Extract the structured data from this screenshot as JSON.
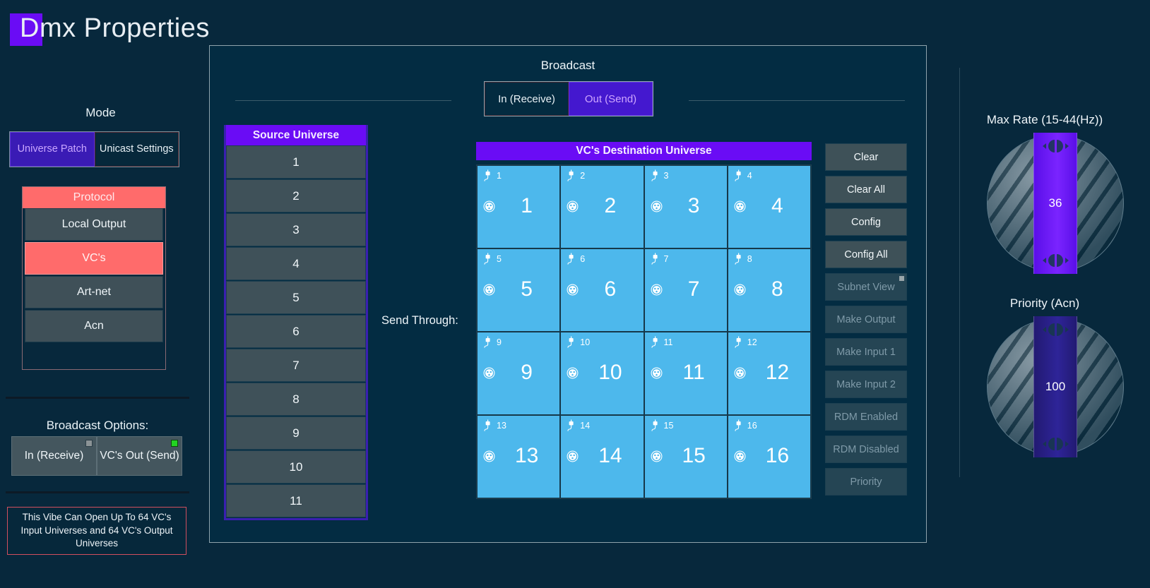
{
  "app": {
    "title": "Dmx Properties",
    "title_initial": "D"
  },
  "mode": {
    "label": "Mode",
    "options": [
      {
        "label": "Universe Patch",
        "active": true
      },
      {
        "label": "Unicast Settings",
        "active": false
      }
    ]
  },
  "protocol": {
    "header": "Protocol",
    "items": [
      {
        "label": "Local Output",
        "selected": false
      },
      {
        "label": "VC's",
        "selected": true
      },
      {
        "label": "Art-net",
        "selected": false
      },
      {
        "label": "Acn",
        "selected": false
      }
    ]
  },
  "broadcast_options": {
    "label": "Broadcast Options:",
    "buttons": [
      {
        "label": "In (Receive)",
        "led": "off"
      },
      {
        "label": "VC's Out (Send)",
        "led": "on"
      }
    ]
  },
  "note": "This Vibe Can Open Up To 64 VC's Input Universes and 64 VC's Output Universes",
  "broadcast": {
    "label": "Broadcast",
    "options": [
      {
        "label": "In (Receive)",
        "active": false
      },
      {
        "label": "Out (Send)",
        "active": true
      }
    ]
  },
  "source_universe": {
    "header": "Source Universe",
    "items": [
      "1",
      "2",
      "3",
      "4",
      "5",
      "6",
      "7",
      "8",
      "9",
      "10",
      "11"
    ]
  },
  "send_through_label": "Send Through:",
  "destination": {
    "header": "VC's Destination Universe",
    "cells": [
      {
        "index": "1",
        "value": "1"
      },
      {
        "index": "2",
        "value": "2"
      },
      {
        "index": "3",
        "value": "3"
      },
      {
        "index": "4",
        "value": "4"
      },
      {
        "index": "5",
        "value": "5"
      },
      {
        "index": "6",
        "value": "6"
      },
      {
        "index": "7",
        "value": "7"
      },
      {
        "index": "8",
        "value": "8"
      },
      {
        "index": "9",
        "value": "9"
      },
      {
        "index": "10",
        "value": "10"
      },
      {
        "index": "11",
        "value": "11"
      },
      {
        "index": "12",
        "value": "12"
      },
      {
        "index": "13",
        "value": "13"
      },
      {
        "index": "14",
        "value": "14"
      },
      {
        "index": "15",
        "value": "15"
      },
      {
        "index": "16",
        "value": "16"
      }
    ]
  },
  "actions": [
    {
      "label": "Clear",
      "enabled": true,
      "led": false
    },
    {
      "label": "Clear All",
      "enabled": true,
      "led": false
    },
    {
      "label": "Config",
      "enabled": true,
      "led": false
    },
    {
      "label": "Config All",
      "enabled": true,
      "led": false
    },
    {
      "label": "Subnet View",
      "enabled": false,
      "led": true
    },
    {
      "label": "Make Output",
      "enabled": false,
      "led": false
    },
    {
      "label": "Make Input 1",
      "enabled": false,
      "led": false
    },
    {
      "label": "Make Input 2",
      "enabled": false,
      "led": false
    },
    {
      "label": "RDM Enabled",
      "enabled": false,
      "led": false
    },
    {
      "label": "RDM Disabled",
      "enabled": false,
      "led": false
    },
    {
      "label": "Priority",
      "enabled": false,
      "led": false
    }
  ],
  "dials": [
    {
      "label": "Max Rate (15-44(Hz))",
      "value": "36",
      "style": "bright"
    },
    {
      "label": "Priority (Acn)",
      "value": "100",
      "style": "dim"
    }
  ],
  "colors": {
    "background": "#07283c",
    "accent_purple": "#6a0cf5",
    "protocol_red": "#ff6b6b",
    "cell_blue": "#4db8ec",
    "button_gray": "#3f5159",
    "led_on": "#22d422",
    "note_border": "#d14f5f"
  }
}
